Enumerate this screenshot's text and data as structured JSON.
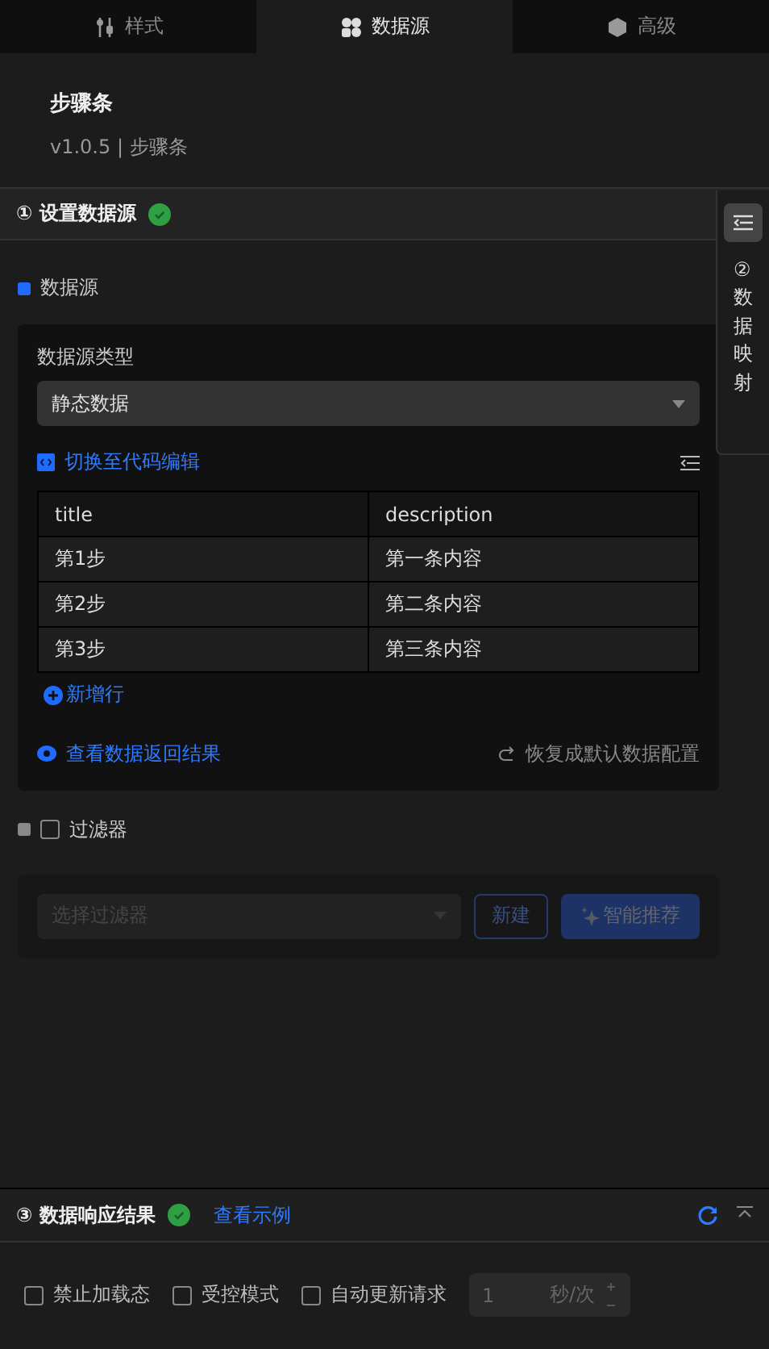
{
  "tabs": [
    {
      "label": "样式",
      "selected": false
    },
    {
      "label": "数据源",
      "selected": true
    },
    {
      "label": "高级",
      "selected": false
    }
  ],
  "component": {
    "name": "步骤条",
    "version": "v1.0.5 | 步骤条"
  },
  "step1": {
    "title": "① 设置数据源",
    "done": true
  },
  "side_panel": {
    "title": "②数据映射"
  },
  "datasource": {
    "label": "数据源",
    "type_label": "数据源类型",
    "type_value": "静态数据",
    "code_link": "切换至代码编辑",
    "table": {
      "columns": [
        "title",
        "description"
      ],
      "rows": [
        [
          "第1步",
          "第一条内容"
        ],
        [
          "第2步",
          "第二条内容"
        ],
        [
          "第3步",
          "第三条内容"
        ]
      ]
    },
    "add_row": "新增行",
    "view_result": "查看数据返回结果",
    "reset": "恢复成默认数据配置"
  },
  "filter": {
    "label": "过滤器",
    "checked": false,
    "placeholder": "选择过滤器",
    "new_button": "新建",
    "smart_button": "智能推荐"
  },
  "step3": {
    "title": "③ 数据响应结果",
    "done": true,
    "example_link": "查看示例"
  },
  "options": [
    {
      "label": "禁止加载态",
      "checked": false
    },
    {
      "label": "受控模式",
      "checked": false
    },
    {
      "label": "自动更新请求",
      "checked": false
    }
  ],
  "interval": {
    "value": "1",
    "unit": "秒/次"
  }
}
